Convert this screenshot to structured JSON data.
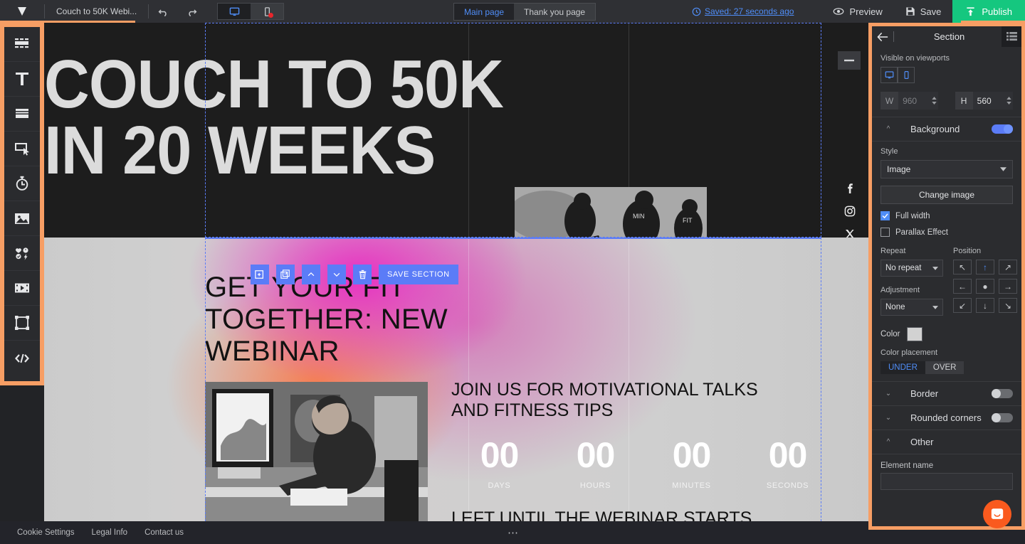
{
  "topbar": {
    "logo_icon": "brand-diamond-icon",
    "project_title": "Couch to 50K Webi...",
    "undo_icon": "undo-icon",
    "redo_icon": "redo-icon",
    "desktop_view_icon": "desktop-icon",
    "mobile_view_icon": "mobile-icon",
    "tabs": [
      {
        "label": "Main page",
        "active": true
      },
      {
        "label": "Thank you page",
        "active": false
      }
    ],
    "saved_status": "Saved: 27 seconds ago",
    "saved_icon": "clock-icon",
    "preview_label": "Preview",
    "preview_icon": "eye-icon",
    "save_label": "Save",
    "save_icon": "floppy-disk-icon",
    "publish_label": "Publish",
    "publish_icon": "upload-icon",
    "publish_color": "#15c77f"
  },
  "left_rail": {
    "highlight_color": "#f79e64",
    "items": [
      {
        "name": "blocks-icon",
        "label": "Blocks"
      },
      {
        "name": "text-icon",
        "label": "Text"
      },
      {
        "name": "layout-rows-icon",
        "label": "Layout"
      },
      {
        "name": "button-icon",
        "label": "Button"
      },
      {
        "name": "timer-icon",
        "label": "Timer"
      },
      {
        "name": "image-icon",
        "label": "Image"
      },
      {
        "name": "icons-icon",
        "label": "Icons"
      },
      {
        "name": "video-icon",
        "label": "Video"
      },
      {
        "name": "frame-icon",
        "label": "Frame"
      },
      {
        "name": "code-icon",
        "label": "Code"
      }
    ]
  },
  "canvas": {
    "zoom_out_icon": "minus-icon",
    "hero": {
      "heading": "COUCH TO 50K IN 20 WEEKS",
      "background_color": "#1d1d1d",
      "social_icons": [
        {
          "name": "facebook-icon",
          "glyph": "f"
        },
        {
          "name": "instagram-icon",
          "glyph": "instagram"
        },
        {
          "name": "x-twitter-icon",
          "glyph": "X"
        }
      ],
      "runners_image_alt": "runners-photo"
    },
    "section_toolbar": {
      "add_icon": "add-section-icon",
      "duplicate_icon": "duplicate-section-icon",
      "move_up_icon": "chevron-up-icon",
      "move_down_icon": "chevron-down-icon",
      "delete_icon": "trash-icon",
      "save_section_label": "SAVE SECTION"
    },
    "section2": {
      "heading": "GET YOUR FIT TOGETHER: NEW WEBINAR",
      "desk_image_alt": "artist-at-desk-photo",
      "countdown_heading": "JOIN US FOR MOTIVATIONAL TALKS AND FITNESS TIPS",
      "countdown": [
        {
          "value": "00",
          "label": "DAYS"
        },
        {
          "value": "00",
          "label": "HOURS"
        },
        {
          "value": "00",
          "label": "MINUTES"
        },
        {
          "value": "00",
          "label": "SECONDS"
        }
      ],
      "countdown_footer": "LEFT UNTIL THE WEBINAR STARTS"
    }
  },
  "right_panel": {
    "back_icon": "back-arrow-icon",
    "title": "Section",
    "list_view_icon": "list-view-icon",
    "viewports_label": "Visible on viewports",
    "viewport_desktop_icon": "desktop-icon",
    "viewport_mobile_icon": "mobile-icon",
    "width_label": "W",
    "width_value": "960",
    "height_label": "H",
    "height_value": "560",
    "background": {
      "title": "Background",
      "enabled": true,
      "style_label": "Style",
      "style_value": "Image",
      "change_image_label": "Change image",
      "full_width_label": "Full width",
      "full_width_checked": true,
      "parallax_label": "Parallax Effect",
      "parallax_checked": false,
      "repeat_label": "Repeat",
      "repeat_value": "No repeat",
      "adjustment_label": "Adjustment",
      "adjustment_value": "None",
      "position_label": "Position",
      "position_cells": [
        "↖",
        "↑",
        "↗",
        "←",
        "●",
        "→",
        "↙",
        "↓",
        "↘"
      ],
      "position_selected_index": 1,
      "color_label": "Color",
      "color_value": "#d2d2d2",
      "color_placement_label": "Color placement",
      "placement_under": "UNDER",
      "placement_over": "OVER",
      "placement_selected": "UNDER"
    },
    "border": {
      "title": "Border",
      "enabled": false
    },
    "rounded_corners": {
      "title": "Rounded corners",
      "enabled": false
    },
    "other": {
      "title": "Other",
      "element_name_label": "Element name",
      "element_name_value": ""
    }
  },
  "footer": {
    "links": [
      "Cookie Settings",
      "Legal Info",
      "Contact us"
    ],
    "more_icon": "more-dots-icon"
  },
  "chat": {
    "icon": "chat-bubble-icon",
    "color": "#fa5a1e"
  }
}
